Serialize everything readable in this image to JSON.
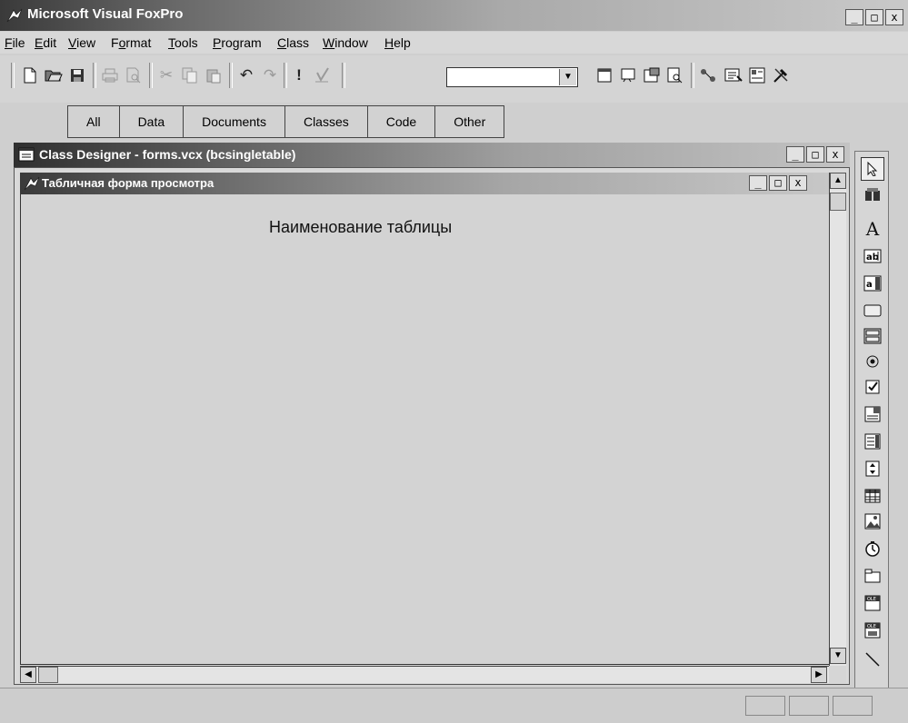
{
  "app": {
    "title": "Microsoft Visual FoxPro"
  },
  "window_buttons": {
    "minimize": "_",
    "maximize": "□",
    "close": "x"
  },
  "menu": [
    {
      "label": "File",
      "key": "F"
    },
    {
      "label": "Edit",
      "key": "E"
    },
    {
      "label": "View",
      "key": "V"
    },
    {
      "label": "Format",
      "key": "o"
    },
    {
      "label": "Tools",
      "key": "T"
    },
    {
      "label": "Program",
      "key": "P"
    },
    {
      "label": "Class",
      "key": "C"
    },
    {
      "label": "Window",
      "key": "W"
    },
    {
      "label": "Help",
      "key": "H"
    }
  ],
  "toolbar": {
    "icons": [
      "new-icon",
      "open-icon",
      "save-icon",
      "print-icon",
      "print-preview-icon",
      "cut-icon",
      "copy-icon",
      "paste-icon",
      "undo-icon",
      "redo-icon",
      "run-icon",
      "modify-form-icon",
      "form-icon",
      "report-icon",
      "properties-icon",
      "preview-icon",
      "data-environment-icon",
      "code-icon",
      "form-controls-icon",
      "builder-icon"
    ],
    "combo_value": ""
  },
  "component_tabs": [
    "All",
    "Data",
    "Documents",
    "Classes",
    "Code",
    "Other"
  ],
  "class_designer": {
    "title": "Class Designer - forms.vcx (bcsingletable)"
  },
  "form": {
    "title": "Табличная форма просмотра",
    "label": "Наименование таблицы"
  },
  "form_controls": [
    "pointer",
    "view-classes",
    "label",
    "textbox",
    "editbox",
    "command-button",
    "command-group",
    "option-group",
    "checkbox",
    "combobox",
    "listbox",
    "spinner",
    "grid",
    "image",
    "timer",
    "pageframe",
    "oleobject",
    "ole-bound-control",
    "line"
  ]
}
